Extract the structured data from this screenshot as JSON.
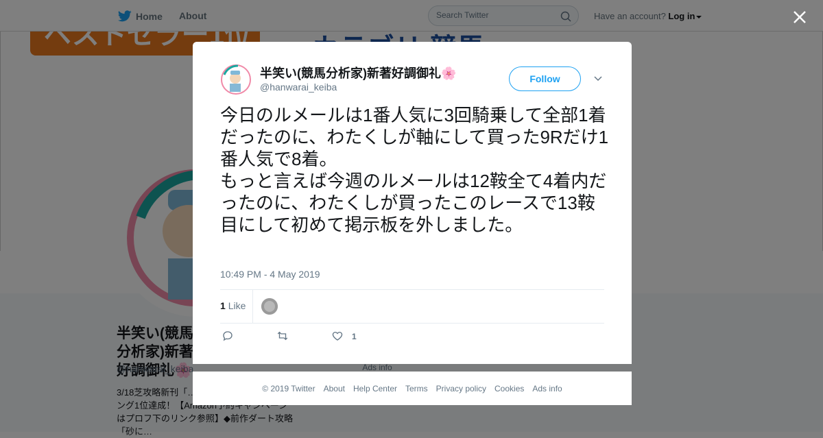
{
  "topbar": {
    "home_label": "Home",
    "about_label": "About",
    "search_placeholder": "Search Twitter",
    "account_prompt": "Have an account?",
    "login_label": "Log in"
  },
  "background": {
    "banner_text_left": "ベストセラー1位",
    "banner_text_right": "・カテゴリ 競馬",
    "profile_name": "半笑い(競馬分析家)新著好調御礼🌸",
    "profile_handle": "@hanwarai_keiba",
    "profile_bio": "3/18芝攻略新刊「…著作Amazon競馬ランキング1位達成！【Amazon予約キャンペーンはプロフ下のリンク参照】◆前作ダート攻略「砂に…",
    "ads_info": "Ads info"
  },
  "tweet": {
    "author_name": "半笑い(競馬分析家)新著好調御礼🌸",
    "author_handle": "@hanwarai_keiba",
    "follow_label": "Follow",
    "text": "今日のルメールは1番人気に3回騎乗して全部1着だったのに、わたくしが軸にして買った9Rだけ1番人気で8着。\nもっと言えば今週のルメールは12鞍全て4着内だったのに、わたくしが買ったこのレースで13鞍目にして初めて掲示板を外しました。",
    "timestamp": "10:49 PM - 4 May 2019",
    "like_count": "1",
    "like_label": "Like",
    "actions": {
      "like_count": "1"
    }
  },
  "footer": {
    "links": [
      "© 2019 Twitter",
      "About",
      "Help Center",
      "Terms",
      "Privacy policy",
      "Cookies",
      "Ads info"
    ]
  },
  "colors": {
    "accent": "#1da1f2",
    "text": "#14171a",
    "secondary": "#657786"
  }
}
